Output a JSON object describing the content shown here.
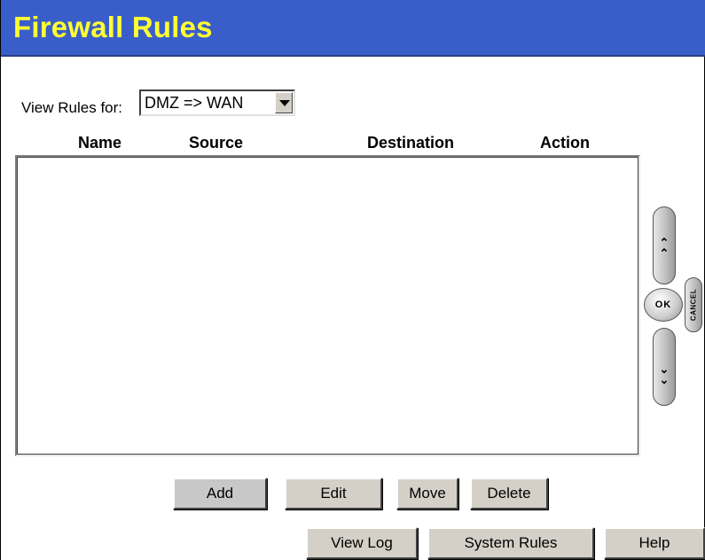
{
  "header": {
    "title": "Firewall Rules"
  },
  "view_rules": {
    "label": "View Rules for:",
    "selected": "DMZ => WAN"
  },
  "table": {
    "columns": [
      "Name",
      "Source",
      "Destination",
      "Action"
    ],
    "rows": []
  },
  "actions": {
    "add": "Add",
    "edit": "Edit",
    "move": "Move",
    "delete": "Delete"
  },
  "footer": {
    "view_log": "View Log",
    "system_rules": "System Rules",
    "help": "Help"
  },
  "nav": {
    "ok": "OK",
    "cancel": "CANCEL",
    "up_icon": "double-chevron-up-icon",
    "down_icon": "double-chevron-down-icon"
  },
  "colors": {
    "header_bg": "#3a5ec9",
    "title_color": "#ffff33",
    "button_face": "#d4d0c8"
  }
}
